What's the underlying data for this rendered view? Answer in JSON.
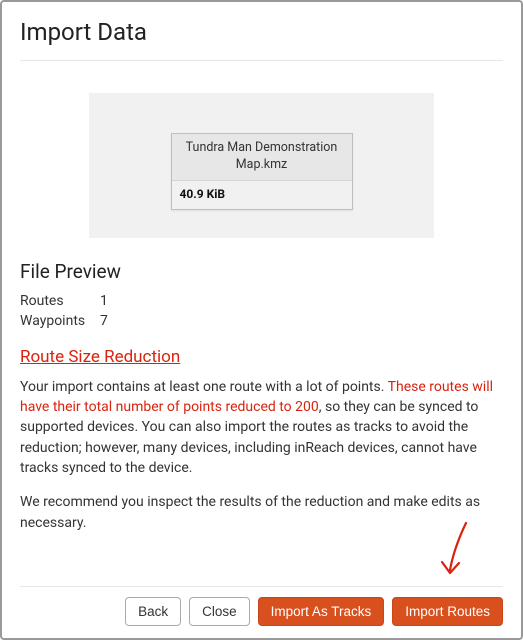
{
  "title": "Import Data",
  "file": {
    "name": "Tundra Man Demonstration Map.kmz",
    "size": "40.9 KiB"
  },
  "preview": {
    "heading": "File Preview",
    "routes_label": "Routes",
    "routes_value": "1",
    "waypoints_label": "Waypoints",
    "waypoints_value": "7"
  },
  "reduction": {
    "link_text": "Route Size Reduction",
    "p1_a": "Your import contains at least one route with a lot of points. ",
    "p1_red": "These routes will have their total number of points reduced to 200",
    "p1_b": ", so they can be synced to supported devices. You can also import the routes as tracks to avoid the reduction; however, many devices, including inReach devices, cannot have tracks synced to the device.",
    "p2": "We recommend you inspect the results of the reduction and make edits as necessary."
  },
  "buttons": {
    "back": "Back",
    "close": "Close",
    "import_as_tracks": "Import As Tracks",
    "import_routes": "Import Routes"
  }
}
